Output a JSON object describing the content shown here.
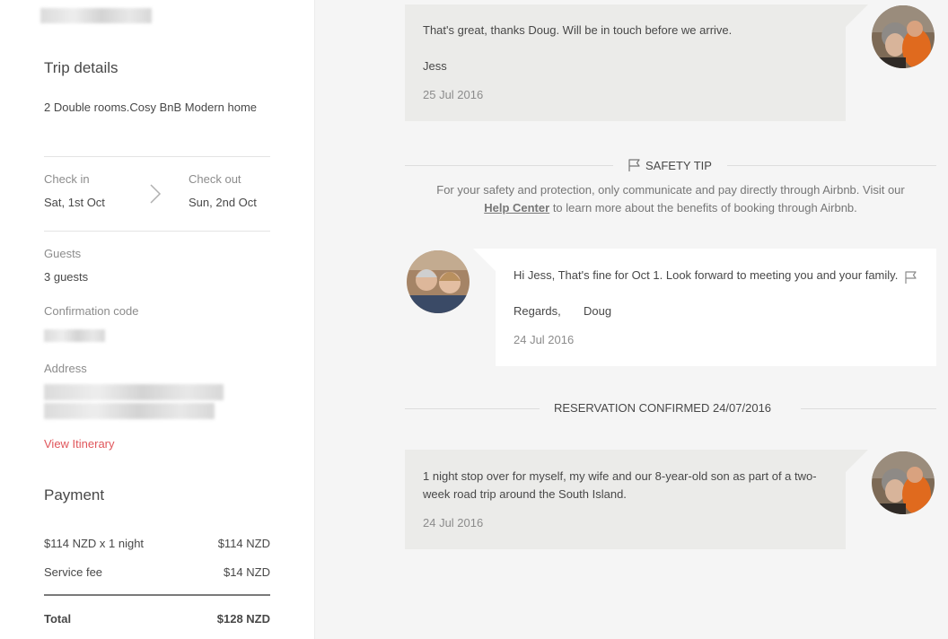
{
  "sidebar": {
    "trip_details_title": "Trip details",
    "listing_name": "2 Double rooms.Cosy BnB Modern home",
    "check_in_label": "Check in",
    "check_in_value": "Sat, 1st Oct",
    "check_out_label": "Check out",
    "check_out_value": "Sun, 2nd Oct",
    "guests_label": "Guests",
    "guests_value": "3 guests",
    "confirmation_label": "Confirmation code",
    "address_label": "Address",
    "view_itinerary": "View Itinerary"
  },
  "payment": {
    "title": "Payment",
    "rows": [
      {
        "label": "$114 NZD x 1 night",
        "amount": "$114 NZD"
      },
      {
        "label": "Service fee",
        "amount": "$14 NZD"
      }
    ],
    "total_label": "Total",
    "total_amount": "$128 NZD"
  },
  "thread": {
    "msg1": {
      "text": "That's great, thanks Doug. Will be in touch before we arrive.",
      "signature": "Jess",
      "date": "25 Jul 2016"
    },
    "safety": {
      "title": "SAFETY TIP",
      "body_before": "For your safety and protection, only communicate and pay directly through Airbnb. Visit our",
      "link": "Help Center",
      "body_after": "to learn more about the benefits of booking through Airbnb."
    },
    "msg2": {
      "line1": "Hi Jess,  That's fine for Oct 1. Look forward to meeting you and your family.",
      "line2": "Regards,       Doug",
      "date": "24 Jul 2016"
    },
    "confirmed_label": "RESERVATION CONFIRMED 24/07/2016",
    "msg3": {
      "text": "1 night stop over for myself, my wife and our 8-year-old son as part of a two-week road trip around the South Island.",
      "date": "24 Jul 2016"
    }
  },
  "icons": [
    "chevron-right-icon",
    "flag-icon"
  ],
  "colors": {
    "link": "#e0565b",
    "bubble_grey": "#ebebe9",
    "page_bg": "#f5f5f5"
  }
}
